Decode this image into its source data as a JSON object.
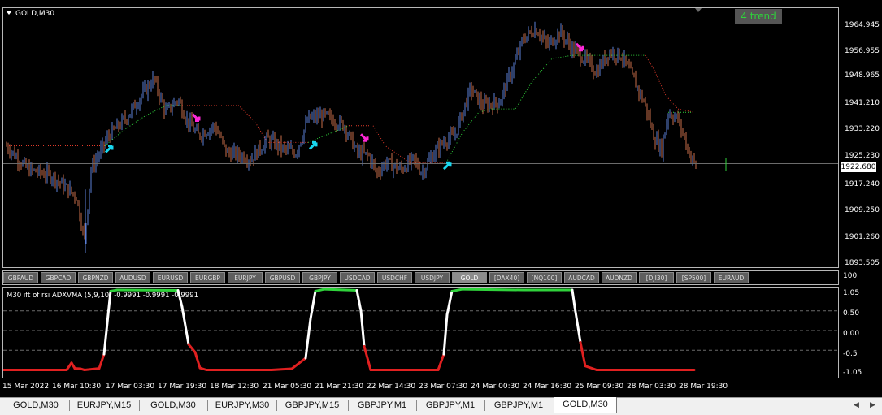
{
  "chart": {
    "title": "GOLD,M30",
    "trend_label": "4 trend",
    "current_price": "1922.680",
    "price_axis": [
      "1964.945",
      "1956.955",
      "1948.965",
      "1941.210",
      "1933.220",
      "1925.230",
      "1917.240",
      "1909.250",
      "1901.260",
      "1893.505"
    ]
  },
  "symbols": [
    "GBPAUD",
    "GBPCAD",
    "GBPNZD",
    "AUDUSD",
    "EURUSD",
    "EURGBP",
    "EURJPY",
    "GBPUSD",
    "GBPJPY",
    "USDCAD",
    "USDCHF",
    "USDJPY",
    "GOLD",
    "[DAX40]",
    "[NQ100]",
    "AUDCAD",
    "AUDNZD",
    "[DJI30]",
    "[SP500]",
    "EURAUD"
  ],
  "active_symbol": "GOLD",
  "indicator": {
    "title": "M30 ift of rsi ADXVMA (5,9,10) -0.9991 -0.9991 -0.9991",
    "axis": [
      "100",
      "1.05",
      "0.50",
      "0.00",
      "-0.5",
      "-1.05"
    ],
    "colors": {
      "up": "#2fd23b",
      "down": "#e02020",
      "mid": "#ffffff"
    }
  },
  "time_axis": [
    "15 Mar 2022",
    "16 Mar 10:30",
    "17 Mar 03:30",
    "17 Mar 19:30",
    "18 Mar 12:30",
    "21 Mar 05:30",
    "21 Mar 21:30",
    "22 Mar 14:30",
    "23 Mar 07:30",
    "24 Mar 00:30",
    "24 Mar 16:30",
    "25 Mar 09:30",
    "28 Mar 03:30",
    "28 Mar 19:30"
  ],
  "tabs": [
    "GOLD,M30",
    "EURJPY,M15",
    "GOLD,M30",
    "EURJPY,M30",
    "GBPJPY,M15",
    "GBPJPY,M1",
    "GBPJPY,M1",
    "GBPJPY,M1",
    "GOLD,M30"
  ],
  "active_tab_index": 8,
  "colors": {
    "bull": "#5b7fd6",
    "bear": "#c86e4a",
    "trail_up": "#2fd23b",
    "trail_down": "#e03a2a",
    "arrow_buy": "#19d8f0",
    "arrow_sell": "#ff28d8"
  }
}
